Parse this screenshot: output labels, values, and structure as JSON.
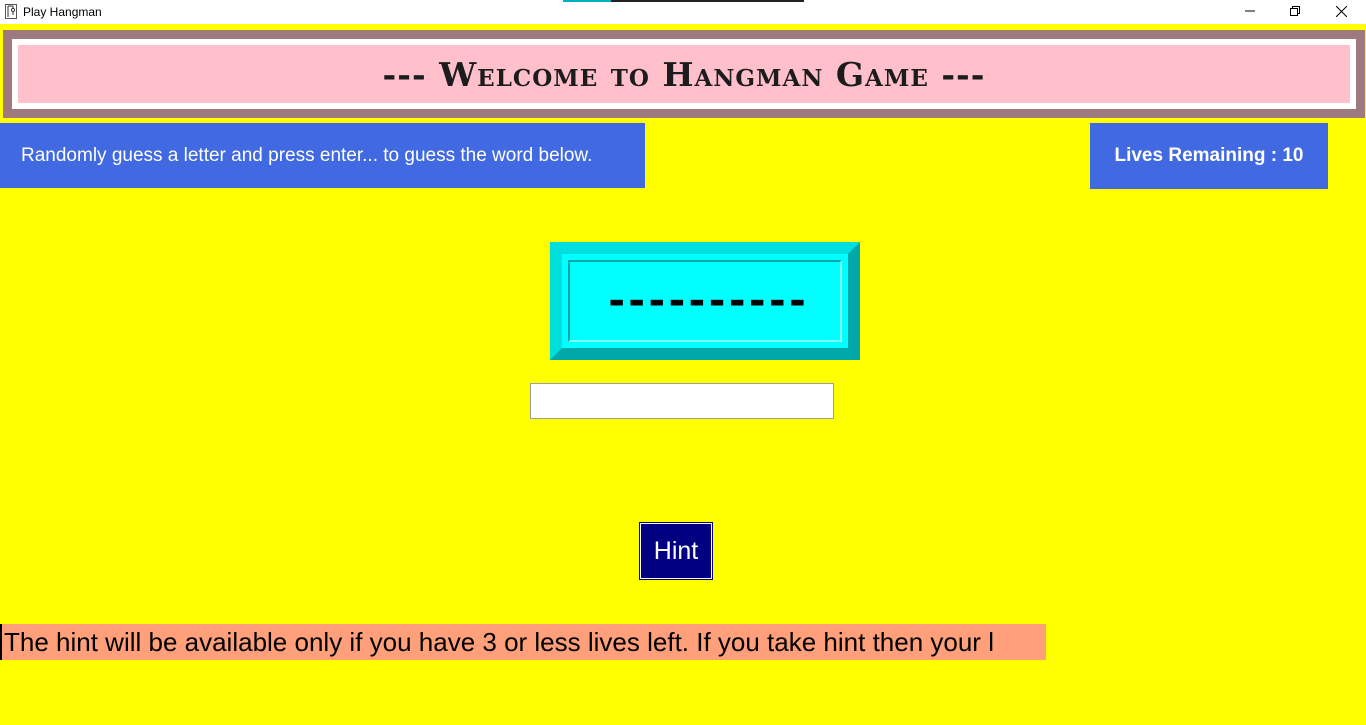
{
  "window": {
    "title": "Play Hangman",
    "controls": [
      "minimize-icon",
      "restore-icon",
      "close-icon"
    ]
  },
  "banner": {
    "text": "--- Welcome to Hangman Game ---"
  },
  "instruction": {
    "text": "Randomly guess a letter and press enter... to guess the word below."
  },
  "lives": {
    "text": "Lives Remaining : 10"
  },
  "word_display": {
    "text": "----------"
  },
  "guess_input": {
    "value": "",
    "placeholder": ""
  },
  "hint_button": {
    "label": "Hint"
  },
  "hint_message": {
    "text": "The hint will be available only if you have 3 or less lives left. If you take hint then your l"
  },
  "colors": {
    "background": "#ffff00",
    "banner_bg": "#ffc0cb",
    "info_bg": "#4169e1",
    "word_bg": "#00ffff",
    "hint_button_bg": "#000080",
    "hint_message_bg": "#ffa07a"
  }
}
